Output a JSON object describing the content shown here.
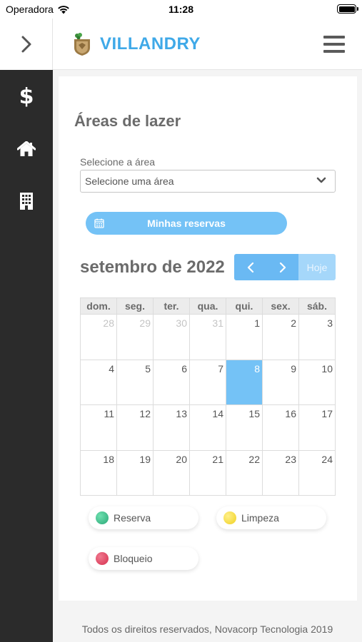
{
  "status_bar": {
    "carrier": "Operadora",
    "time": "11:28"
  },
  "header": {
    "brand": "VILLANDRY"
  },
  "sidebar": {
    "items": [
      {
        "icon": "dollar-icon",
        "glyph": "$"
      },
      {
        "icon": "home-icon"
      },
      {
        "icon": "building-icon"
      }
    ]
  },
  "page": {
    "title": "Áreas de lazer"
  },
  "area_select": {
    "label": "Selecione a área",
    "value": "Selecione uma área"
  },
  "reservas_button": {
    "label": "Minhas reservas"
  },
  "calendar": {
    "month_label": "setembro de 2022",
    "today_label": "Hoje",
    "weekdays": [
      "dom.",
      "seg.",
      "ter.",
      "qua.",
      "qui.",
      "sex.",
      "sáb."
    ],
    "weeks": [
      [
        "28",
        "29",
        "30",
        "31",
        "1",
        "2",
        "3"
      ],
      [
        "4",
        "5",
        "6",
        "7",
        "8",
        "9",
        "10"
      ],
      [
        "11",
        "12",
        "13",
        "14",
        "15",
        "16",
        "17"
      ],
      [
        "18",
        "19",
        "20",
        "21",
        "22",
        "23",
        "24"
      ]
    ],
    "selected_day": "8"
  },
  "legend": [
    {
      "label": "Reserva",
      "color": "#3dbf8a"
    },
    {
      "label": "Limpeza",
      "color": "#f5dd3c"
    },
    {
      "label": "Bloqueio",
      "color": "#e04a64"
    }
  ],
  "footer": {
    "text": "Todos os direitos reservados, Novacorp Tecnologia 2019"
  },
  "colors": {
    "accent": "#74c2f6",
    "brand": "#3fa9e8",
    "sidebar": "#2b2b2b"
  }
}
